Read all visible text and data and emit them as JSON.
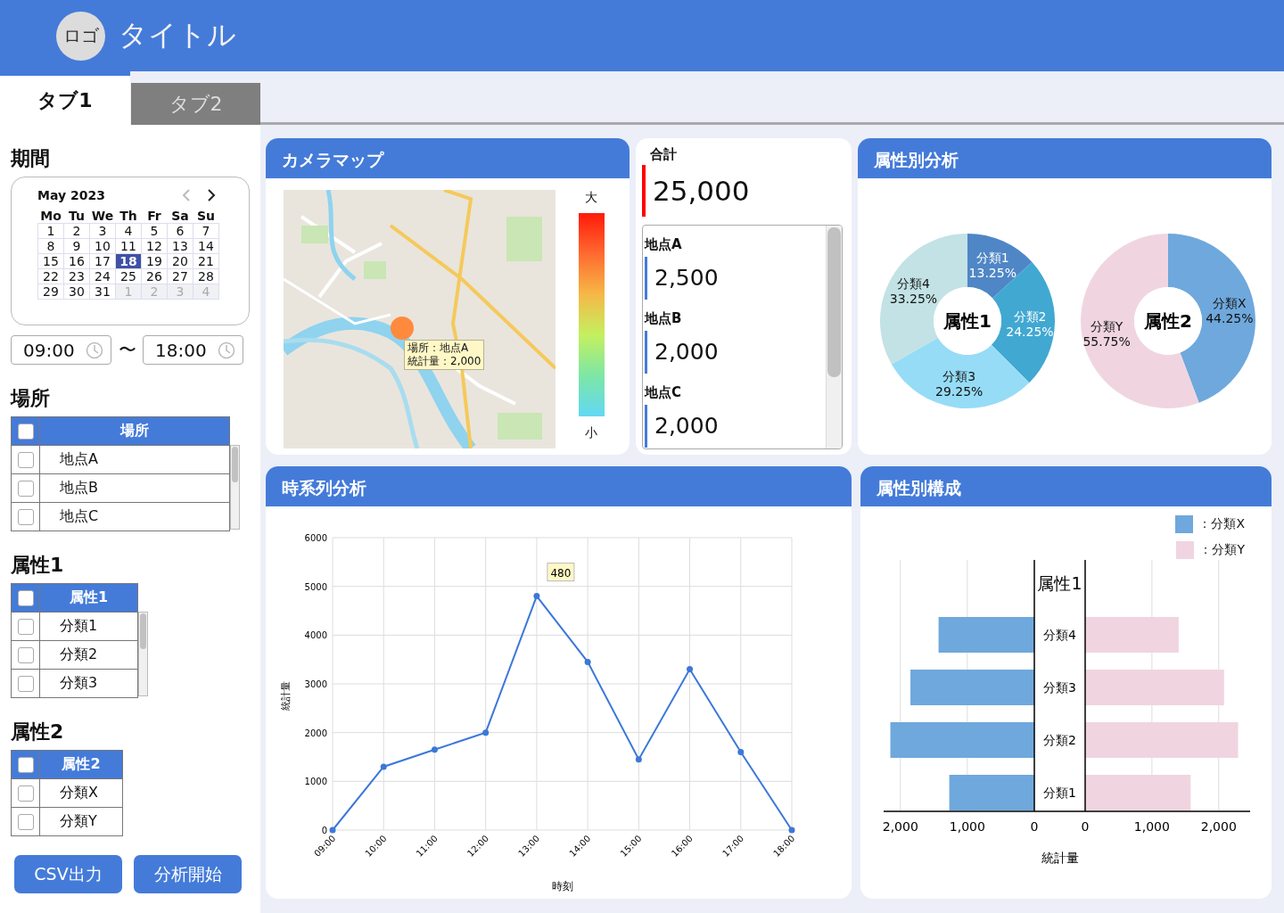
{
  "header": {
    "logo": "ロゴ",
    "title": "タイトル"
  },
  "tabs": [
    {
      "label": "タブ1",
      "selected": true
    },
    {
      "label": "タブ2",
      "selected": false
    }
  ],
  "sidebar": {
    "period": {
      "heading": "期間",
      "calendar": {
        "month": "May 2023",
        "prev_disabled": true,
        "weekdays": [
          "Mo",
          "Tu",
          "We",
          "Th",
          "Fr",
          "Sa",
          "Su"
        ],
        "weeks": [
          [
            {
              "day": "1",
              "selected": false,
              "outside": false
            },
            {
              "day": "2",
              "selected": false,
              "outside": false
            },
            {
              "day": "3",
              "selected": false,
              "outside": false
            },
            {
              "day": "4",
              "selected": false,
              "outside": false
            },
            {
              "day": "5",
              "selected": false,
              "outside": false
            },
            {
              "day": "6",
              "selected": false,
              "outside": false
            },
            {
              "day": "7",
              "selected": false,
              "outside": false
            }
          ],
          [
            {
              "day": "8",
              "selected": false,
              "outside": false
            },
            {
              "day": "9",
              "selected": false,
              "outside": false
            },
            {
              "day": "10",
              "selected": false,
              "outside": false
            },
            {
              "day": "11",
              "selected": false,
              "outside": false
            },
            {
              "day": "12",
              "selected": false,
              "outside": false
            },
            {
              "day": "13",
              "selected": false,
              "outside": false
            },
            {
              "day": "14",
              "selected": false,
              "outside": false
            }
          ],
          [
            {
              "day": "15",
              "selected": false,
              "outside": false
            },
            {
              "day": "16",
              "selected": false,
              "outside": false
            },
            {
              "day": "17",
              "selected": false,
              "outside": false
            },
            {
              "day": "18",
              "selected": true,
              "outside": false
            },
            {
              "day": "19",
              "selected": false,
              "outside": false
            },
            {
              "day": "20",
              "selected": false,
              "outside": false
            },
            {
              "day": "21",
              "selected": false,
              "outside": false
            }
          ],
          [
            {
              "day": "22",
              "selected": false,
              "outside": false
            },
            {
              "day": "23",
              "selected": false,
              "outside": false
            },
            {
              "day": "24",
              "selected": false,
              "outside": false
            },
            {
              "day": "25",
              "selected": false,
              "outside": false
            },
            {
              "day": "26",
              "selected": false,
              "outside": false
            },
            {
              "day": "27",
              "selected": false,
              "outside": false
            },
            {
              "day": "28",
              "selected": false,
              "outside": false
            }
          ],
          [
            {
              "day": "29",
              "selected": false,
              "outside": false
            },
            {
              "day": "30",
              "selected": false,
              "outside": false
            },
            {
              "day": "31",
              "selected": false,
              "outside": false
            },
            {
              "day": "1",
              "selected": false,
              "outside": true
            },
            {
              "day": "2",
              "selected": false,
              "outside": true
            },
            {
              "day": "3",
              "selected": false,
              "outside": true
            },
            {
              "day": "4",
              "selected": false,
              "outside": true
            }
          ]
        ]
      },
      "start_time": "09:00",
      "separator": "〜",
      "end_time": "18:00"
    },
    "location": {
      "heading": "場所",
      "column": "場所",
      "all_checked": false,
      "scrollbar": true,
      "rows": [
        {
          "label": "地点A",
          "checked": false
        },
        {
          "label": "地点B",
          "checked": false
        },
        {
          "label": "地点C",
          "checked": false
        }
      ]
    },
    "attribute1": {
      "heading": "属性1",
      "column": "属性1",
      "all_checked": false,
      "scrollbar": true,
      "rows": [
        {
          "label": "分類1",
          "checked": false
        },
        {
          "label": "分類2",
          "checked": false
        },
        {
          "label": "分類3",
          "checked": false
        }
      ]
    },
    "attribute2": {
      "heading": "属性2",
      "column": "属性2",
      "all_checked": false,
      "scrollbar": false,
      "rows": [
        {
          "label": "分類X",
          "checked": false
        },
        {
          "label": "分類Y",
          "checked": false
        }
      ]
    },
    "buttons": [
      {
        "label": "CSV出力"
      },
      {
        "label": "分析開始"
      }
    ]
  },
  "camera_map": {
    "title": "カメラマップ",
    "tooltip": [
      "場所：地点A",
      "統計量：2,000"
    ],
    "legend": {
      "max_label": "大",
      "min_label": "小"
    }
  },
  "total": {
    "label": "合計",
    "value": "25,000",
    "locations": [
      {
        "name": "地点A",
        "value": "2,500"
      },
      {
        "name": "地点B",
        "value": "2,000"
      },
      {
        "name": "地点C",
        "value": "2,000"
      }
    ]
  },
  "attribute_analysis": {
    "title": "属性別分析",
    "donuts": [
      {
        "chart_data": {
          "type": "donut",
          "title": "属性1",
          "categories": [
            "分類1",
            "分類2",
            "分類3",
            "分類4"
          ],
          "values": [
            13.25,
            24.25,
            29.25,
            33.25
          ],
          "value_labels": [
            "13.25%",
            "24.25%",
            "29.25%",
            "33.25%"
          ],
          "colors": [
            "#4f86c6",
            "#41a8d2",
            "#96dcf6",
            "#c2e2e5"
          ]
        }
      },
      {
        "chart_data": {
          "type": "donut",
          "title": "属性2",
          "categories": [
            "分類X",
            "分類Y"
          ],
          "values": [
            44.25,
            55.75
          ],
          "value_labels": [
            "44.25%",
            "55.75%"
          ],
          "colors": [
            "#6fa8dc",
            "#f0d5e0"
          ]
        }
      }
    ]
  },
  "time_series": {
    "title": "時系列分析",
    "chart_data": {
      "type": "line",
      "xlabel": "時刻",
      "ylabel": "統計量",
      "x": [
        "09:00",
        "10:00",
        "11:00",
        "12:00",
        "13:00",
        "14:00",
        "15:00",
        "16:00",
        "17:00",
        "18:00"
      ],
      "series": [
        {
          "color": "#3c78d8",
          "marker": "circle",
          "values": [
            0,
            1300,
            1650,
            2000,
            4800,
            3450,
            1450,
            3300,
            1600,
            0
          ]
        }
      ],
      "ylim": [
        0,
        6000
      ],
      "yticks": [
        0,
        1000,
        2000,
        3000,
        4000,
        5000,
        6000
      ],
      "grid": true,
      "annotations": [
        {
          "text": "480"
        }
      ]
    }
  },
  "composition": {
    "title": "属性別構成",
    "charts": [
      {
        "chart_data": {
          "type": "bar",
          "orientation": "horizontal",
          "title": "属性1",
          "xlabel": "統計量",
          "categories": [
            "分類4",
            "分類3",
            "分類2",
            "分類1"
          ],
          "series": [
            {
              "name": "：分類X",
              "color": "#6fa8dc",
              "values": [
                1430,
                1850,
                2150,
                1270
              ]
            }
          ],
          "xlim": [
            2250,
            0
          ],
          "xticks": [
            {
              "value": 2000,
              "label": "2,000"
            },
            {
              "value": 1000,
              "label": "1,000"
            },
            {
              "value": 0,
              "label": "0"
            }
          ]
        }
      },
      {
        "chart_data": {
          "type": "bar",
          "orientation": "horizontal",
          "series": [
            {
              "name": "：分類Y",
              "color": "#f0d5e0",
              "values": [
                1400,
                2080,
                2290,
                1580
              ]
            }
          ],
          "xlim": [
            0,
            2470
          ],
          "xticks": [
            {
              "value": 0,
              "label": "0"
            },
            {
              "value": 1000,
              "label": "1,000"
            },
            {
              "value": 2000,
              "label": "2,000"
            }
          ]
        }
      }
    ]
  }
}
